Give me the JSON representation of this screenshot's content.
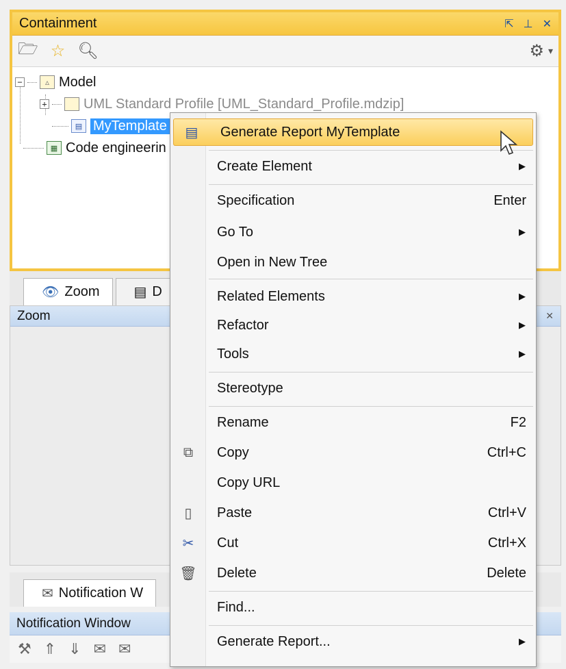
{
  "containment": {
    "title": "Containment",
    "tree": {
      "model": "Model",
      "profile": "UML Standard Profile [UML_Standard_Profile.mdzip]",
      "template": "MyTemplate",
      "code": "Code engineerin"
    }
  },
  "tabs": {
    "zoom": "Zoom",
    "second_initial": "D",
    "notification": "Notification W"
  },
  "zoom_panel": {
    "title": "Zoom"
  },
  "notification_panel": {
    "title": "Notification Window"
  },
  "context_menu": {
    "items": [
      {
        "label": "Generate Report MyTemplate",
        "shortcut": "",
        "submenu": false,
        "icon": "report-template-icon"
      },
      {
        "label": "Create Element",
        "shortcut": "",
        "submenu": true,
        "icon": ""
      },
      {
        "label": "Specification",
        "shortcut": "Enter",
        "submenu": false,
        "icon": ""
      },
      {
        "label": "Go To",
        "shortcut": "",
        "submenu": true,
        "icon": ""
      },
      {
        "label": "Open in New Tree",
        "shortcut": "",
        "submenu": false,
        "icon": ""
      },
      {
        "label": "Related Elements",
        "shortcut": "",
        "submenu": true,
        "icon": ""
      },
      {
        "label": "Refactor",
        "shortcut": "",
        "submenu": true,
        "icon": ""
      },
      {
        "label": "Tools",
        "shortcut": "",
        "submenu": true,
        "icon": ""
      },
      {
        "label": "Stereotype",
        "shortcut": "",
        "submenu": false,
        "icon": ""
      },
      {
        "label": "Rename",
        "shortcut": "F2",
        "submenu": false,
        "icon": ""
      },
      {
        "label": "Copy",
        "shortcut": "Ctrl+C",
        "submenu": false,
        "icon": "copy-icon"
      },
      {
        "label": "Copy URL",
        "shortcut": "",
        "submenu": false,
        "icon": ""
      },
      {
        "label": "Paste",
        "shortcut": "Ctrl+V",
        "submenu": false,
        "icon": "paste-icon"
      },
      {
        "label": "Cut",
        "shortcut": "Ctrl+X",
        "submenu": false,
        "icon": "cut-icon"
      },
      {
        "label": "Delete",
        "shortcut": "Delete",
        "submenu": false,
        "icon": "delete-icon"
      },
      {
        "label": "Find...",
        "shortcut": "",
        "submenu": false,
        "icon": ""
      },
      {
        "label": "Generate Report...",
        "shortcut": "",
        "submenu": true,
        "icon": ""
      }
    ]
  },
  "colors": {
    "containment_border": "#f5c542",
    "selection": "#3399ff",
    "menu_highlight": "#fbcf5c"
  }
}
